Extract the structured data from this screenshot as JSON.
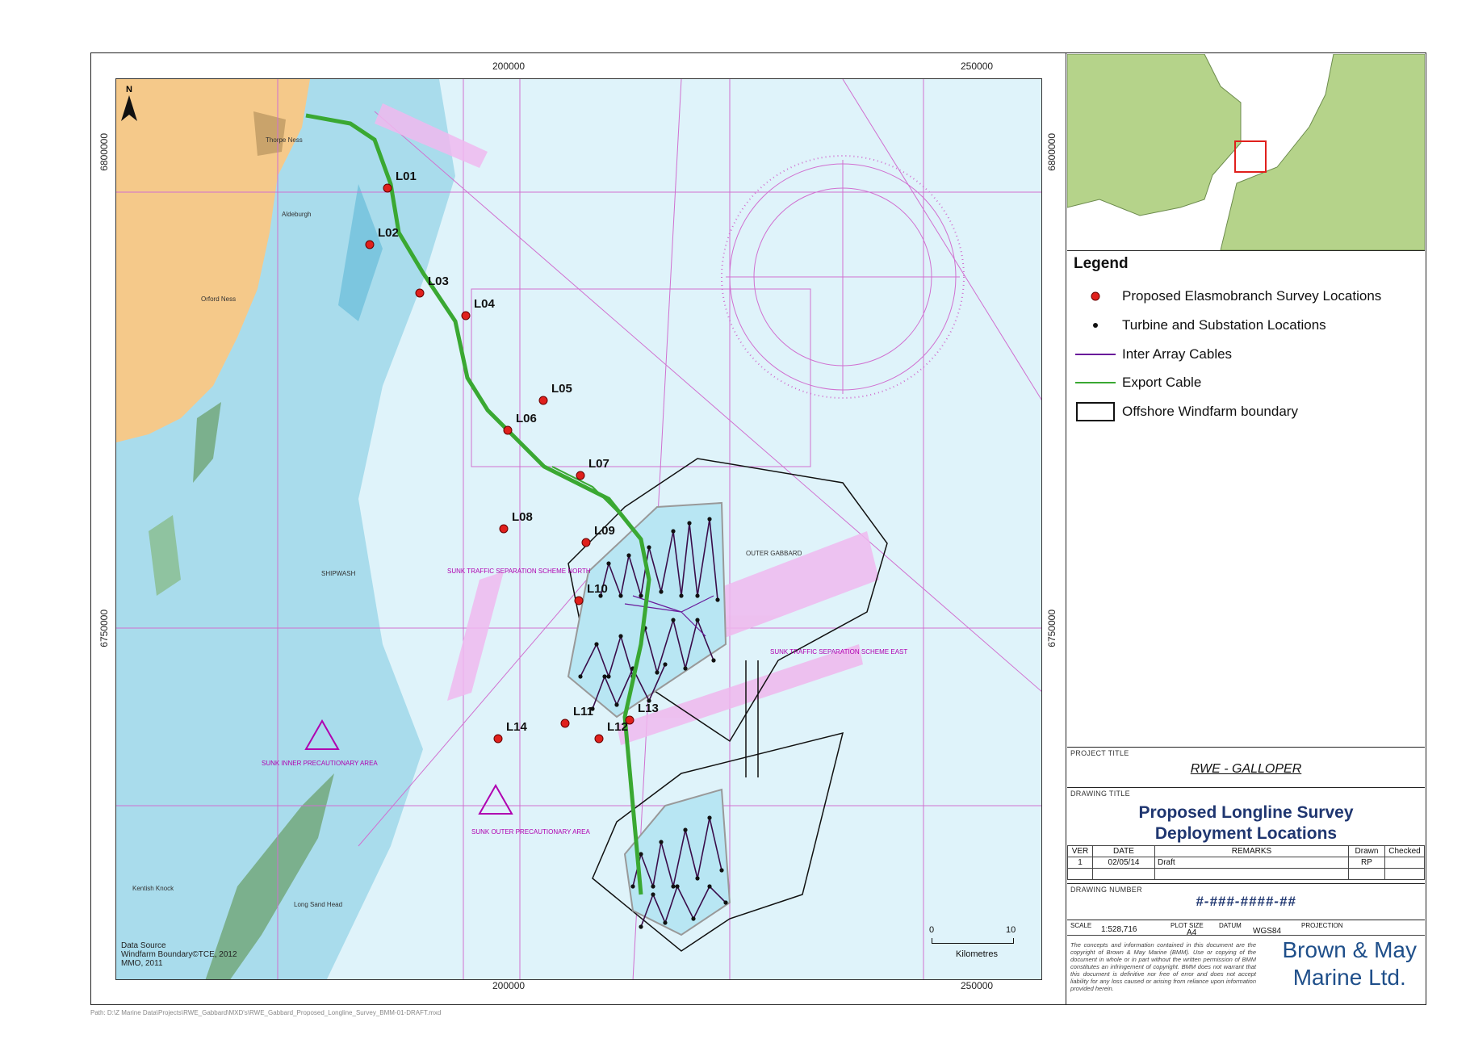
{
  "coords": {
    "x_left": "200000",
    "x_right": "250000",
    "y_top": "6800000",
    "y_bottom": "6750000"
  },
  "map_labels": {
    "north": "N",
    "thorpe_ness": "Thorpe Ness",
    "aldeburgh": "Aldeburgh",
    "orford_ness": "Orford Ness",
    "shipwash": "SHIPWASH",
    "outer_gabbard": "OUTER GABBARD",
    "sunk_north": "SUNK TRAFFIC SEPARATION SCHEME NORTH",
    "sunk_east": "SUNK TRAFFIC SEPARATION SCHEME EAST",
    "sunk_inner": "SUNK INNER PRECAUTIONARY AREA",
    "sunk_outer": "SUNK OUTER PRECAUTIONARY AREA",
    "kentish_knock": "Kentish Knock",
    "long_sand": "Long Sand Head"
  },
  "sites": [
    {
      "id": "L01",
      "label": "L01"
    },
    {
      "id": "L02",
      "label": "L02"
    },
    {
      "id": "L03",
      "label": "L03"
    },
    {
      "id": "L04",
      "label": "L04"
    },
    {
      "id": "L05",
      "label": "L05"
    },
    {
      "id": "L06",
      "label": "L06"
    },
    {
      "id": "L07",
      "label": "L07"
    },
    {
      "id": "L08",
      "label": "L08"
    },
    {
      "id": "L09",
      "label": "L09"
    },
    {
      "id": "L10",
      "label": "L10"
    },
    {
      "id": "L11",
      "label": "L11"
    },
    {
      "id": "L12",
      "label": "L12"
    },
    {
      "id": "L13",
      "label": "L13"
    },
    {
      "id": "L14",
      "label": "L14"
    }
  ],
  "data_source": {
    "line1": "Data Source",
    "line2": "Windfarm Boundary©TCE, 2012",
    "line3": "MMO, 2011"
  },
  "scalebar": {
    "min": "0",
    "max": "10",
    "unit": "Kilometres"
  },
  "legend": {
    "title": "Legend",
    "items": [
      {
        "label": "Proposed Elasmobranch Survey Locations",
        "symbol": "red-dot",
        "color": "#e0201c"
      },
      {
        "label": "Turbine and Substation Locations",
        "symbol": "black-dot",
        "color": "#111111"
      },
      {
        "label": "Inter Array Cables",
        "symbol": "purple-line",
        "color": "#6a1b9a"
      },
      {
        "label": "Export Cable",
        "symbol": "green-line",
        "color": "#3aa832"
      },
      {
        "label": "Offshore Windfarm boundary",
        "symbol": "black-box",
        "color": "#111111"
      }
    ]
  },
  "title_block": {
    "project_label": "PROJECT TITLE",
    "project_title": "RWE - GALLOPER",
    "drawing_label": "DRAWING TITLE",
    "drawing_title_1": "Proposed Longline Survey",
    "drawing_title_2": "Deployment Locations",
    "rev_headers": [
      "VER",
      "DATE",
      "REMARKS",
      "Drawn",
      "Checked"
    ],
    "rev_rows": [
      [
        "1",
        "02/05/14",
        "Draft",
        "RP",
        ""
      ]
    ],
    "drawing_number_label": "DRAWING NUMBER",
    "drawing_number": "#-###-####-##",
    "scale_label": "SCALE",
    "scale_value": "1:528,716",
    "plot_label": "PLOT SIZE",
    "plot_value": "A4",
    "datum_label": "DATUM",
    "datum_value": "WGS84",
    "projection_label": "PROJECTION",
    "disclaimer": "The concepts and information contained in this document are the copyright of Brown & May Marine (BMM). Use or copying of the document in whole or in part without the written permission of BMM constitutes an infringement of copyright. BMM does not warrant that this document is definitive nor free of error and does not accept liability for any loss caused or arising from reliance upon information provided herein.",
    "company_1": "Brown & May",
    "company_2": "Marine Ltd."
  },
  "path": "Path: D:\\Z Marine Data\\Projects\\RWE_Gabbard\\MXD's\\RWE_Gabbard_Proposed_Longline_Survey_BMM-01-DRAFT.mxd",
  "colors": {
    "land": "#f5c98a",
    "shallow": "#a9dcec",
    "deep": "#dff3fa",
    "tss": "#f0b8ee",
    "inset_land": "#b5d38a",
    "export_cable": "#3aa832",
    "inter_array": "#6a1b9a",
    "site": "#e0201c"
  }
}
